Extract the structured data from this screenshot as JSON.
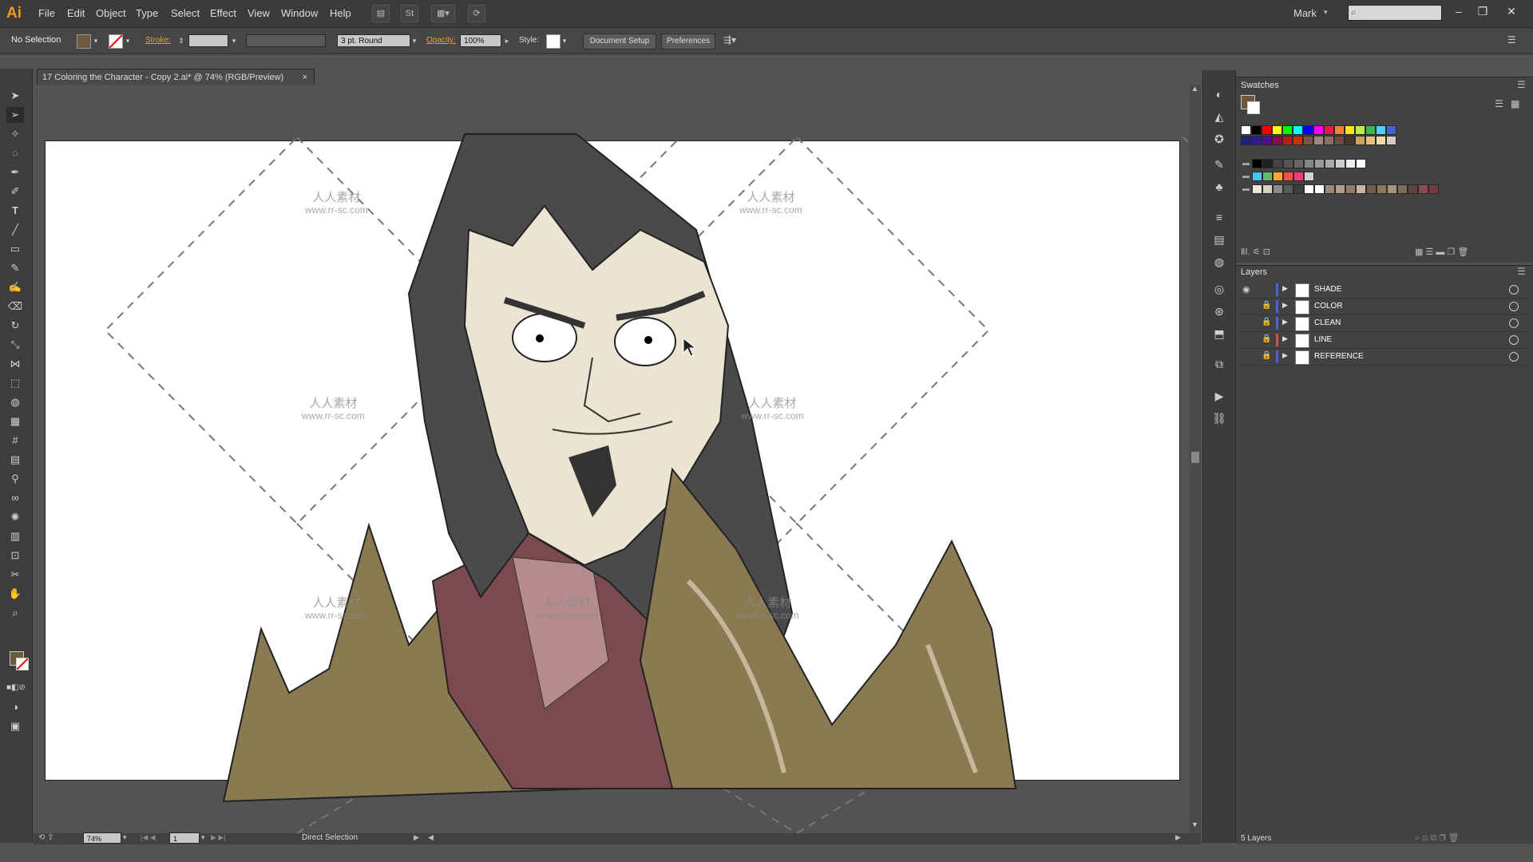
{
  "app": {
    "logo": "Ai",
    "user": "Mark"
  },
  "menu": [
    "File",
    "Edit",
    "Object",
    "Type",
    "Select",
    "Effect",
    "View",
    "Window",
    "Help"
  ],
  "control_bar": {
    "selection": "No Selection",
    "stroke_label": "Stroke:",
    "brush": "3 pt. Round",
    "opacity_label": "Opacity:",
    "opacity_value": "100%",
    "style_label": "Style:",
    "document_setup": "Document Setup",
    "preferences": "Preferences"
  },
  "document_tab": {
    "title": "17 Coloring the Character - Copy 2.ai* @ 74% (RGB/Preview)",
    "close": "×"
  },
  "status": {
    "zoom": "74%",
    "artboard": "1",
    "tool": "Direct Selection"
  },
  "swatches": {
    "title": "Swatches",
    "row1": [
      "#ffffff",
      "#000000",
      "#ff0000",
      "#ffff00",
      "#00ff00",
      "#00ffff",
      "#0000ff",
      "#ff00ff",
      "#e6194b",
      "#f58231",
      "#ffe119",
      "#bfef45",
      "#3cb44b",
      "#42d4f4",
      "#4363d8"
    ],
    "row2": [
      "#1a237e",
      "#311b92",
      "#4a148c",
      "#880e4f",
      "#b71c1c",
      "#bf360c",
      "#795548",
      "#a1887f",
      "#8d6e63",
      "#6d4c41",
      "#4e342e",
      "#c8a165",
      "#e6c17d",
      "#f3d9a4",
      "#d7ccc8"
    ],
    "grays": [
      "#000000",
      "#222222",
      "#444444",
      "#555555",
      "#666666",
      "#888888",
      "#999999",
      "#aaaaaa",
      "#cccccc",
      "#eeeeee",
      "#ffffff"
    ],
    "group1": [
      "#4fc3f7",
      "#66bb6a",
      "#ffa726",
      "#ef5350",
      "#ec407a",
      "#cfcfcf"
    ],
    "group2": [
      "#efe7d8",
      "#d8d1c0",
      "#8c8c8c",
      "#595959",
      "#3d3d3d",
      "#ffffff",
      "#ffffff",
      "#9b8a7a",
      "#b59a8e",
      "#8f7d6a",
      "#c6b79c",
      "#6e5f4c",
      "#8a7a5c",
      "#a29576",
      "#7b6e59",
      "#5e4540",
      "#8a4a4f",
      "#733b3f"
    ]
  },
  "layers": {
    "title": "Layers",
    "items": [
      {
        "name": "SHADE",
        "color": "#4f5fd6"
      },
      {
        "name": "COLOR",
        "color": "#4f5fd6"
      },
      {
        "name": "CLEAN",
        "color": "#4f5fd6"
      },
      {
        "name": "LINE",
        "color": "#d64f4f"
      },
      {
        "name": "REFERENCE",
        "color": "#4f5fd6"
      }
    ],
    "count": "5 Layers"
  },
  "watermark": {
    "cn": "人人素材",
    "url": "www.rr-sc.com",
    "top_url": "www.rr-sc.com"
  },
  "colors": {
    "hair": "#4a4a4a",
    "skin": "#ece4d3",
    "armor": "#8a7a52",
    "neck": "#7a4a4f"
  }
}
